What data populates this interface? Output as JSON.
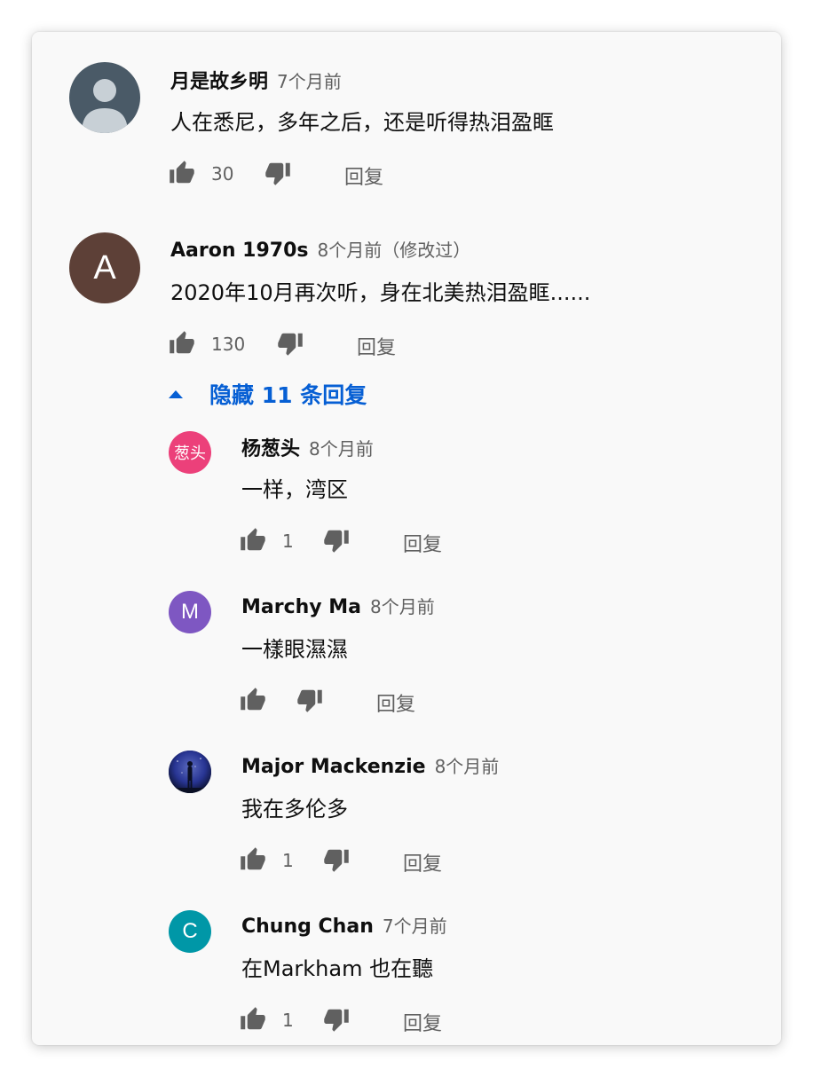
{
  "comments": [
    {
      "author": "月是故乡明",
      "time": "7个月前",
      "text": "人在悉尼，多年之后，还是听得热泪盈眶",
      "likes": "30",
      "reply_label": "回复",
      "avatar": {
        "type": "default-person-icon",
        "color": "#4a5a67"
      }
    },
    {
      "author": "Aaron 1970s",
      "time": "8个月前（修改过）",
      "text": "2020年10月再次听，身在北美热泪盈眶......",
      "likes": "130",
      "reply_label": "回复",
      "avatar": {
        "type": "letter",
        "letter": "A",
        "color": "#5d4037"
      }
    }
  ],
  "replies_toggle": {
    "label": "隐藏 11 条回复",
    "color": "#065fd4"
  },
  "replies": [
    {
      "author": "杨葱头",
      "time": "8个月前",
      "text": "一样，湾区",
      "likes": "1",
      "reply_label": "回复",
      "avatar": {
        "type": "text",
        "letter": "葱头",
        "color": "#ec407a"
      }
    },
    {
      "author": "Marchy Ma",
      "time": "8个月前",
      "text": "一樣眼濕濕",
      "likes": "",
      "reply_label": "回复",
      "avatar": {
        "type": "letter",
        "letter": "M",
        "color": "#7e57c2"
      }
    },
    {
      "author": "Major Mackenzie",
      "time": "8个月前",
      "text": "我在多伦多",
      "likes": "1",
      "reply_label": "回复",
      "avatar": {
        "type": "photo-night-sky-icon",
        "color": "#1a237e"
      }
    },
    {
      "author": "Chung Chan",
      "time": "7个月前",
      "text": "在Markham 也在聽",
      "likes": "1",
      "reply_label": "回复",
      "avatar": {
        "type": "letter",
        "letter": "C",
        "color": "#0097a7"
      }
    }
  ],
  "colors": {
    "text": "#0f0f0f",
    "secondary": "#606060",
    "link": "#065fd4",
    "background": "#f9f9f9"
  }
}
